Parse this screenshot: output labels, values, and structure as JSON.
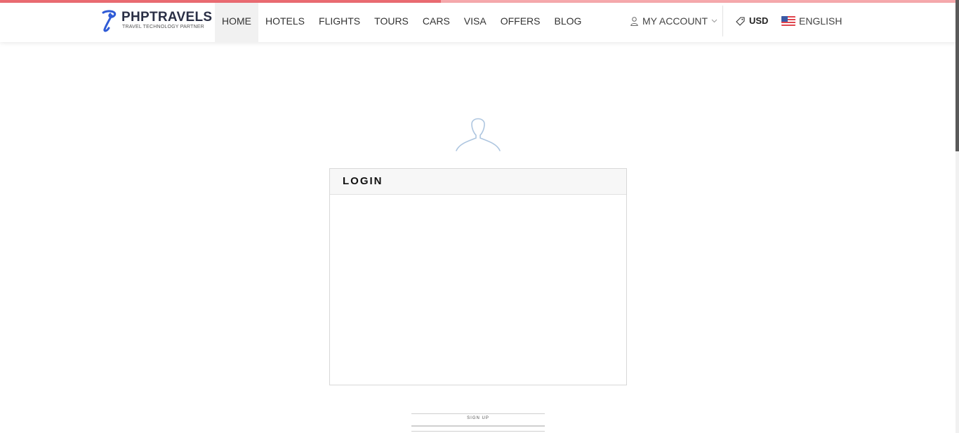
{
  "progress": {
    "fraction": 0.46,
    "fill_color": "#ea6b72",
    "track_color": "#f6a9ad"
  },
  "brand": {
    "name": "PHPTRAVELS",
    "tagline": "TRAVEL TECHNOLOGY PARTNER",
    "mark_icon": "phptravels-logo-icon",
    "color": "#2f5bd6"
  },
  "nav": {
    "items": [
      {
        "label": "HOME",
        "active": true
      },
      {
        "label": "HOTELS"
      },
      {
        "label": "FLIGHTS"
      },
      {
        "label": "TOURS"
      },
      {
        "label": "CARS"
      },
      {
        "label": "VISA"
      },
      {
        "label": "OFFERS"
      },
      {
        "label": "BLOG"
      }
    ]
  },
  "account": {
    "label": "MY ACCOUNT",
    "icon": "user-icon",
    "caret_icon": "chevron-down-icon"
  },
  "currency": {
    "label": "USD",
    "icon": "tag-icon"
  },
  "language": {
    "label": "ENGLISH",
    "icon": "us-flag-icon"
  },
  "main": {
    "avatar_icon": "user-silhouette-icon",
    "login_title": "LOGIN",
    "signup_label": "SIGN UP"
  }
}
